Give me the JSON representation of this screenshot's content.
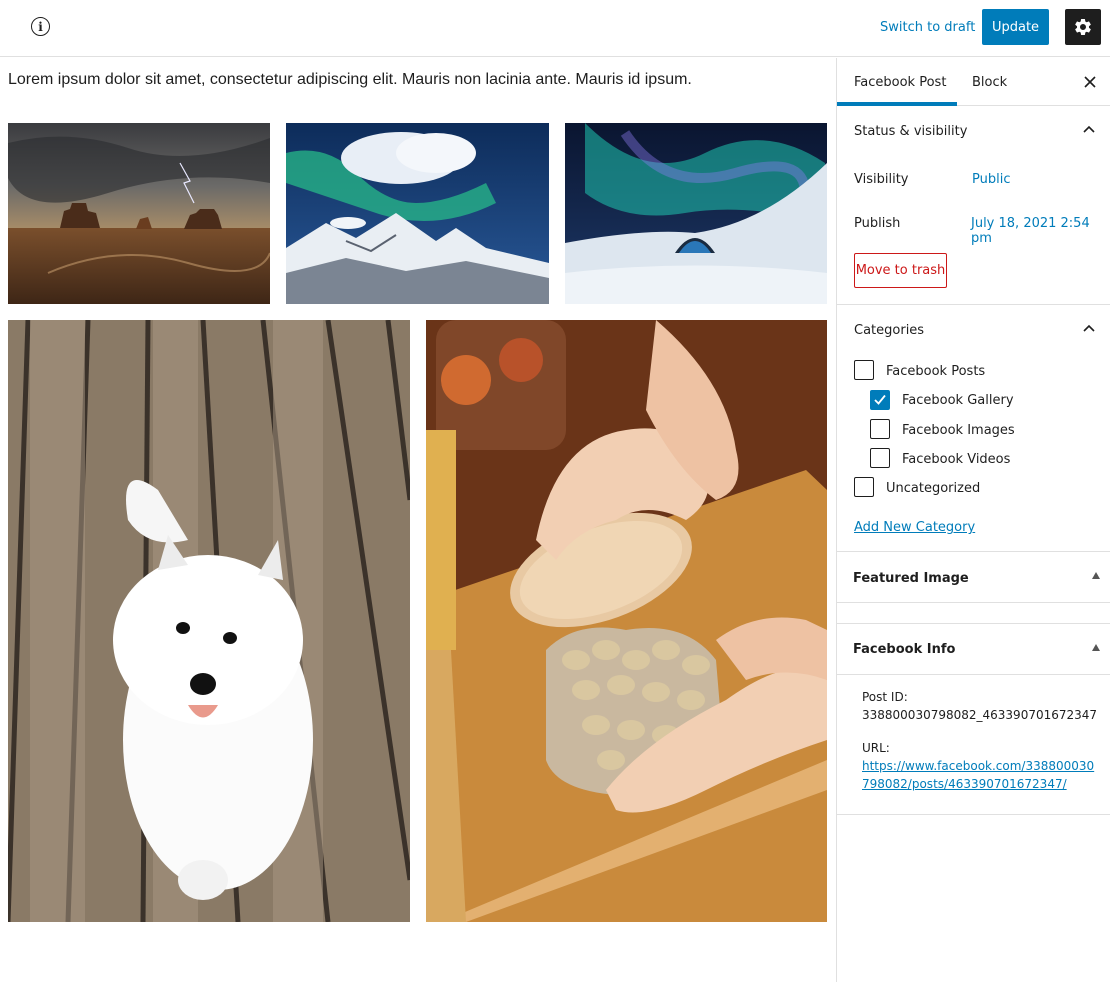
{
  "header": {
    "info_icon": "info-icon",
    "switch_to_draft": "Switch to draft",
    "update": "Update",
    "settings_icon": "gear-icon"
  },
  "content": {
    "paragraph": "Lorem ipsum dolor sit amet, consectetur adipiscing elit. Mauris non lacinia ante. Mauris id ipsum.",
    "gallery": [
      {
        "subject": "desert-monument-valley-lightning"
      },
      {
        "subject": "aurora-over-snowy-mountains"
      },
      {
        "subject": "aurora-over-ice-hotel"
      },
      {
        "subject": "white-samoyed-puppy-on-wooden-deck"
      },
      {
        "subject": "hands-opening-jar-of-pistachios"
      }
    ]
  },
  "sidebar": {
    "tabs": [
      "Facebook Post",
      "Block"
    ],
    "status": {
      "title": "Status & visibility",
      "visibility_label": "Visibility",
      "visibility_value": "Public",
      "publish_label": "Publish",
      "publish_value": "July 18, 2021 2:54 pm",
      "trash": "Move to trash"
    },
    "categories": {
      "title": "Categories",
      "items": [
        {
          "label": "Facebook Posts",
          "checked": false,
          "level": 0
        },
        {
          "label": "Facebook Gallery",
          "checked": true,
          "level": 1
        },
        {
          "label": "Facebook Images",
          "checked": false,
          "level": 1
        },
        {
          "label": "Facebook Videos",
          "checked": false,
          "level": 1
        },
        {
          "label": "Uncategorized",
          "checked": false,
          "level": 0
        }
      ],
      "add_new": "Add New Category"
    },
    "featured_image": {
      "title": "Featured Image"
    },
    "facebook_info": {
      "title": "Facebook Info",
      "post_id_label": "Post ID:",
      "post_id_value": "338800030798082_463390701672347",
      "url_label": "URL:",
      "url_value": "https://www.facebook.com/338800030798082/posts/463390701672347/"
    }
  },
  "colors": {
    "accent": "#007cba",
    "danger": "#cc1818",
    "border": "#e0e0e0",
    "text": "#1e1e1e"
  }
}
